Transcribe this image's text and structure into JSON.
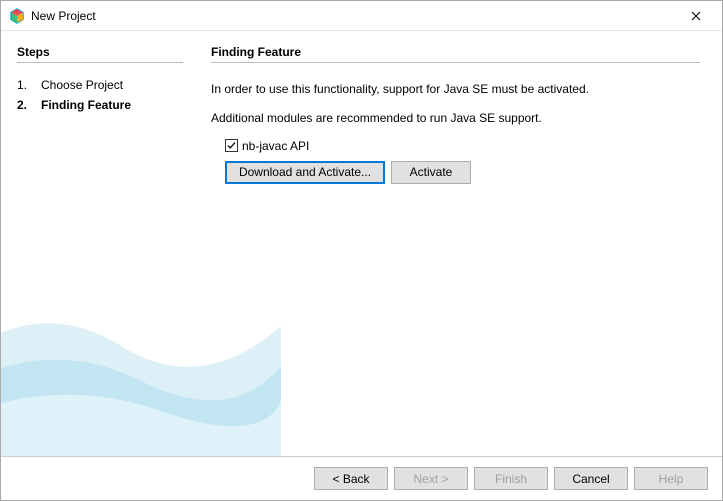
{
  "window": {
    "title": "New Project"
  },
  "sidebar": {
    "heading": "Steps",
    "steps": [
      {
        "num": "1.",
        "label": "Choose Project",
        "current": false
      },
      {
        "num": "2.",
        "label": "Finding Feature",
        "current": true
      }
    ]
  },
  "main": {
    "heading": "Finding Feature",
    "intro": "In order to use this functionality, support for Java SE must be activated.",
    "subtext": "Additional modules are recommended to run Java SE support.",
    "checkbox": {
      "checked": true,
      "label": "nb-javac API"
    },
    "buttons": {
      "download": "Download and Activate...",
      "activate": "Activate"
    }
  },
  "footer": {
    "back": "< Back",
    "next": "Next >",
    "finish": "Finish",
    "cancel": "Cancel",
    "help": "Help"
  }
}
